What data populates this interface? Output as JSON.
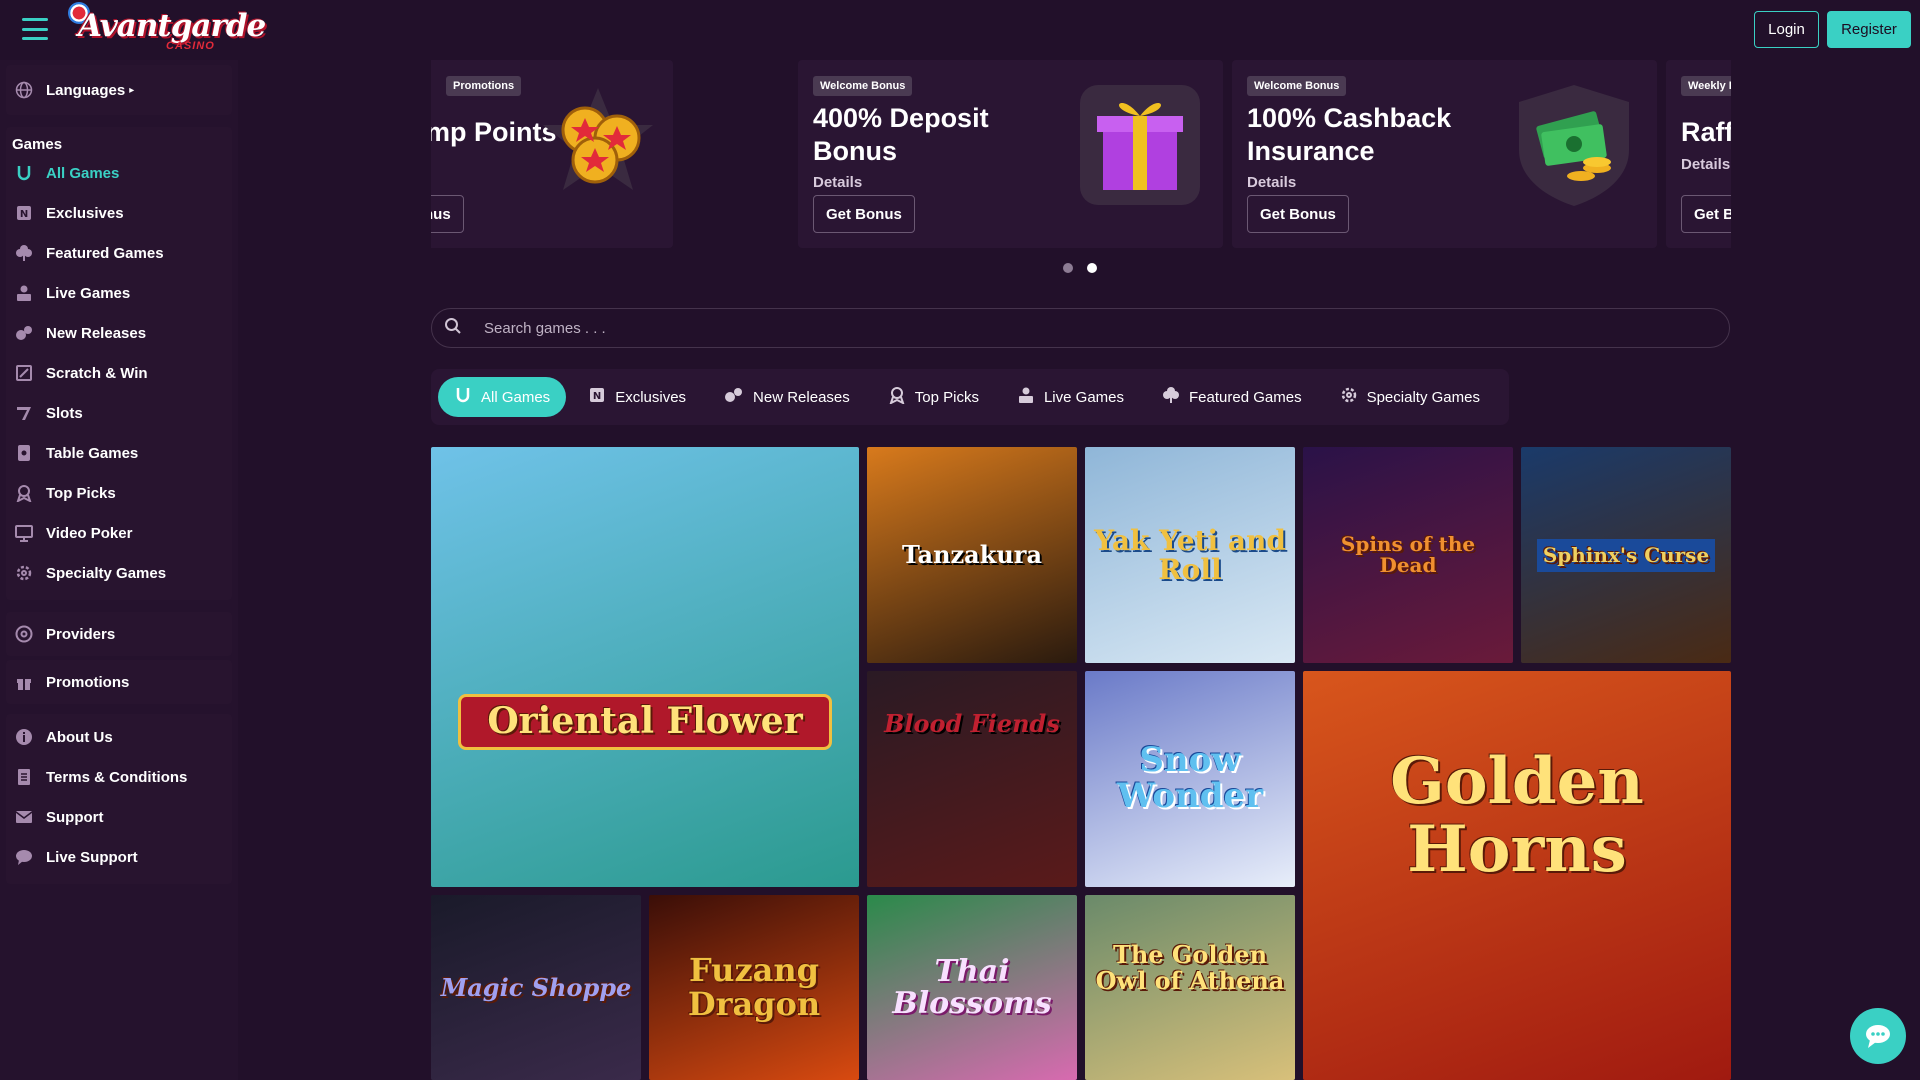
{
  "header": {
    "logo_text": "Avantgarde",
    "logo_sub": "CASINO",
    "login_label": "Login",
    "register_label": "Register"
  },
  "sidebar": {
    "languages_label": "Languages",
    "games_heading": "Games",
    "games": [
      {
        "label": "All Games",
        "icon": "horseshoe-icon",
        "active": true
      },
      {
        "label": "Exclusives",
        "icon": "exclusive-icon"
      },
      {
        "label": "Featured Games",
        "icon": "clover-icon"
      },
      {
        "label": "Live Games",
        "icon": "live-dealer-icon"
      },
      {
        "label": "New Releases",
        "icon": "new-icon"
      },
      {
        "label": "Scratch & Win",
        "icon": "scratch-icon"
      },
      {
        "label": "Slots",
        "icon": "cherry-icon"
      },
      {
        "label": "Table Games",
        "icon": "card-icon"
      },
      {
        "label": "Top Picks",
        "icon": "award-icon"
      },
      {
        "label": "Video Poker",
        "icon": "monitor-icon"
      },
      {
        "label": "Specialty Games",
        "icon": "gear-icon"
      }
    ],
    "providers_label": "Providers",
    "promotions_label": "Promotions",
    "info": [
      {
        "label": "About Us",
        "icon": "info-icon"
      },
      {
        "label": "Terms & Conditions",
        "icon": "document-icon"
      },
      {
        "label": "Support",
        "icon": "mail-icon"
      },
      {
        "label": "Live Support",
        "icon": "chat-icon"
      }
    ]
  },
  "promos": [
    {
      "tag": "Promotions",
      "title": "mp Points",
      "details": "",
      "button": "Bonus",
      "art": "coins"
    },
    {
      "tag": "Welcome Bonus",
      "title": "400% Deposit Bonus",
      "details": "Details",
      "button": "Get Bonus",
      "art": "gift"
    },
    {
      "tag": "Welcome Bonus",
      "title": "100% Cashback Insurance",
      "details": "Details",
      "button": "Get Bonus",
      "art": "cash"
    },
    {
      "tag": "Weekly R",
      "title": "Raff",
      "details": "Details",
      "button": "Get B",
      "art": "none"
    }
  ],
  "carousel_pages": 2,
  "carousel_active_page": 2,
  "search": {
    "placeholder": "Search games . . ."
  },
  "tabs": [
    {
      "label": "All Games",
      "icon": "horseshoe-icon",
      "active": true
    },
    {
      "label": "Exclusives",
      "icon": "exclusive-icon"
    },
    {
      "label": "New Releases",
      "icon": "new-icon"
    },
    {
      "label": "Top Picks",
      "icon": "award-icon"
    },
    {
      "label": "Live Games",
      "icon": "live-dealer-icon"
    },
    {
      "label": "Featured Games",
      "icon": "clover-icon"
    },
    {
      "label": "Specialty Games",
      "icon": "gear-icon"
    }
  ],
  "games": [
    {
      "title": "Oriental Flower",
      "colors": [
        "#6fc2e8",
        "#2b9a8f"
      ]
    },
    {
      "title": "Tanzakura",
      "colors": [
        "#d87a1c",
        "#2a1a0e"
      ]
    },
    {
      "title": "Yak Yeti and Roll",
      "colors": [
        "#8fb6d8",
        "#d9e8f4"
      ]
    },
    {
      "title": "Spins of the Dead",
      "colors": [
        "#2a1248",
        "#6a1a3a"
      ]
    },
    {
      "title": "Sphinx's Curse",
      "colors": [
        "#1a3a6a",
        "#4a2a14"
      ]
    },
    {
      "title": "Blood Fiends",
      "colors": [
        "#2a1a24",
        "#5a1a1a"
      ]
    },
    {
      "title": "Snow Wonder",
      "colors": [
        "#6a7ac8",
        "#e8eefa"
      ]
    },
    {
      "title": "Golden Horns",
      "colors": [
        "#d8561c",
        "#a01a10"
      ]
    },
    {
      "title": "Magic Shoppe",
      "colors": [
        "#1a1a2a",
        "#3a2a4a"
      ]
    },
    {
      "title": "Fuzang Dragon",
      "colors": [
        "#3a0e08",
        "#d84a10"
      ]
    },
    {
      "title": "Thai Blossoms",
      "colors": [
        "#2a8a4a",
        "#d86ab0"
      ]
    },
    {
      "title": "The Golden Owl of Athena",
      "colors": [
        "#6a8a6a",
        "#d8c07a"
      ]
    }
  ]
}
